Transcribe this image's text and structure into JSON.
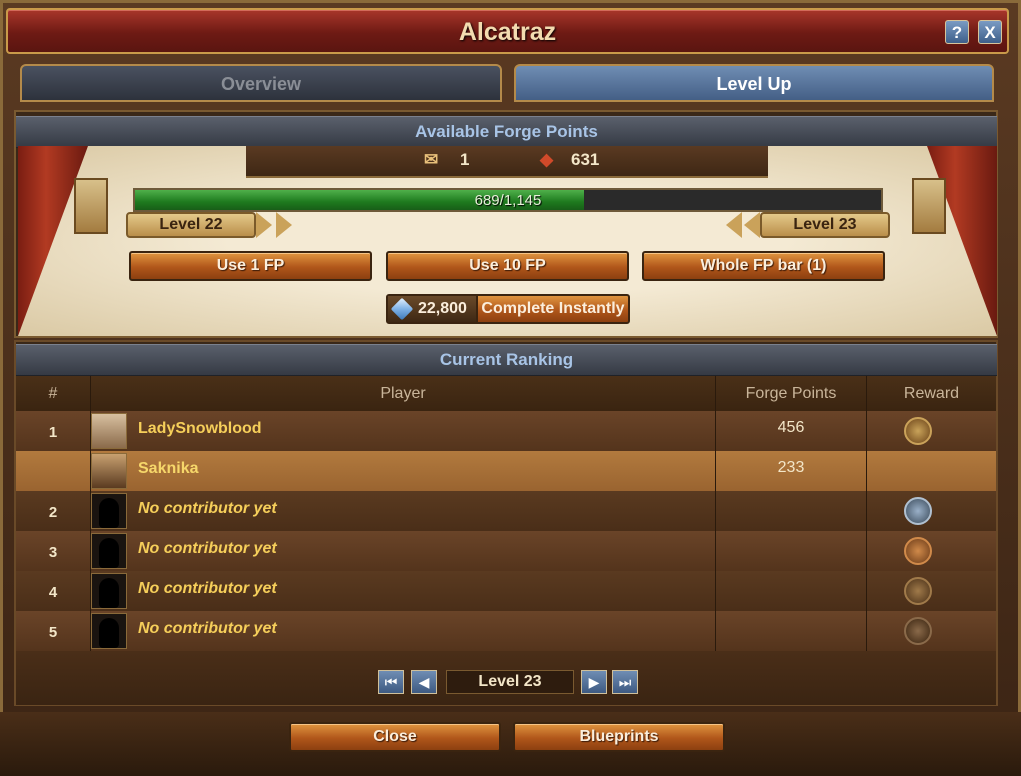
{
  "window": {
    "title": "Alcatraz",
    "help_label": "?",
    "close_label": "X"
  },
  "tabs": [
    {
      "label": "Overview",
      "active": false
    },
    {
      "label": "Level Up",
      "active": true
    }
  ],
  "forge": {
    "heading": "Available Forge Points",
    "blueprints_count": "1",
    "forge_points": "631",
    "progress_text": "689/1,145",
    "progress_fraction": 0.6017,
    "current_level": "Level 22",
    "next_level": "Level 23",
    "buttons": {
      "use1": "Use 1 FP",
      "use10": "Use 10 FP",
      "whole": "Whole FP bar (1)"
    },
    "instant_cost": "22,800",
    "instant_label": "Complete Instantly"
  },
  "ranking": {
    "heading": "Current Ranking",
    "columns": [
      "#",
      "Player",
      "Forge Points",
      "Reward"
    ],
    "rows": [
      {
        "rank": "1",
        "player": "LadySnowblood",
        "fp": "456"
      },
      {
        "rank": "",
        "player": "Saknika",
        "fp": "233"
      },
      {
        "rank": "2",
        "player": "No contributor yet",
        "fp": ""
      },
      {
        "rank": "3",
        "player": "No contributor yet",
        "fp": ""
      },
      {
        "rank": "4",
        "player": "No contributor yet",
        "fp": ""
      },
      {
        "rank": "5",
        "player": "No contributor yet",
        "fp": ""
      }
    ],
    "pager_label": "Level 23"
  },
  "footer": {
    "close_label": "Close",
    "blueprints_label": "Blueprints"
  },
  "colors": {
    "accent": "#b0561a",
    "highlight_row": "#b27a3e",
    "progress": "#1e7a1e",
    "tab_active": "#445f86"
  },
  "icons": {
    "help": "help-icon",
    "close": "close-icon",
    "blueprint": "blueprint-icon",
    "forge_point": "forge-point-icon",
    "diamond": "diamond-icon",
    "chest": "chest-icon",
    "first": "first-page-icon",
    "prev": "prev-page-icon",
    "next": "next-page-icon",
    "last": "last-page-icon"
  }
}
